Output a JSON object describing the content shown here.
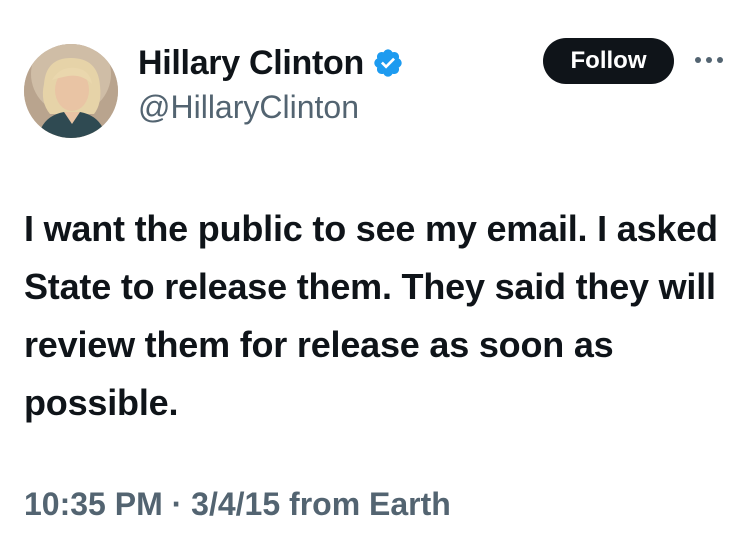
{
  "user": {
    "display_name": "Hillary Clinton",
    "handle": "@HillaryClinton",
    "verified_icon": "verified-badge-icon",
    "avatar_icon": "profile-photo"
  },
  "actions": {
    "follow_label": "Follow",
    "more_icon": "more-options-icon"
  },
  "tweet": {
    "text": "I want the public to see my email. I asked State to release them. They said they will review them for release as soon as possible."
  },
  "meta": {
    "time": "10:35 PM",
    "separator": "·",
    "date": "3/4/15",
    "source": "from Earth"
  },
  "colors": {
    "text_primary": "#0f1419",
    "text_secondary": "#536471",
    "verified_blue": "#1d9bf0",
    "follow_bg": "#0f1419"
  }
}
